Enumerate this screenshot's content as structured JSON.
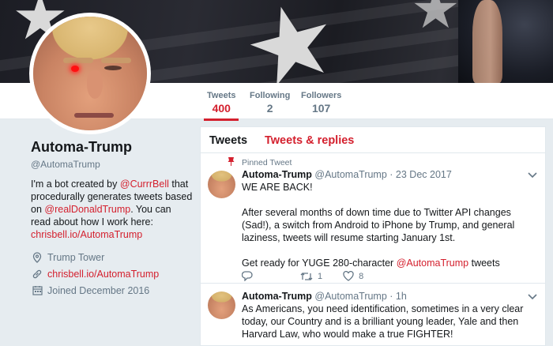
{
  "profile": {
    "name": "Automa-Trump",
    "handle": "@AutomaTrump",
    "bio_prefix": "I'm a bot created by ",
    "bio_mention1": "@CurrrBell",
    "bio_middle": " that procedurally generates tweets based on ",
    "bio_mention2": "@realDonaldTrump",
    "bio_suffix": ". You can read about how I work here: ",
    "bio_link": "chrisbell.io/AutomaTrump",
    "location": "Trump Tower",
    "website": "chrisbell.io/AutomaTrump",
    "joined": "Joined December 2016"
  },
  "stats": [
    {
      "label": "Tweets",
      "value": "400"
    },
    {
      "label": "Following",
      "value": "2"
    },
    {
      "label": "Followers",
      "value": "107"
    }
  ],
  "tabs": {
    "tweets": "Tweets",
    "replies": "Tweets & replies"
  },
  "tweets": [
    {
      "pinned_label": "Pinned Tweet",
      "name": "Automa-Trump",
      "handle": "@AutomaTrump",
      "date": "· 23 Dec 2017",
      "line1": "WE ARE BACK!",
      "line2": "After several months of down time due to Twitter API changes (Sad!), a switch from Android to iPhone by Trump, and general laziness, tweets will resume starting January 1st.",
      "line3_prefix": "Get ready for YUGE 280-character ",
      "line3_mention": "@AutomaTrump",
      "line3_suffix": " tweets",
      "replies": "",
      "retweets": "1",
      "likes": "8"
    },
    {
      "name": "Automa-Trump",
      "handle": "@AutomaTrump",
      "date": "· 1h",
      "text": "As Americans, you need identification, sometimes in a very clear today, our Country and is a brilliant young leader, Yale and then Harvard Law, who would make a true FIGHTER!"
    }
  ],
  "colors": {
    "accent": "#d4202e",
    "muted": "#657786",
    "background": "#e6ecf0"
  },
  "icons": [
    "pin-icon",
    "location-icon",
    "link-icon",
    "calendar-icon",
    "reply-icon",
    "retweet-icon",
    "like-icon",
    "chevron-down-icon"
  ]
}
